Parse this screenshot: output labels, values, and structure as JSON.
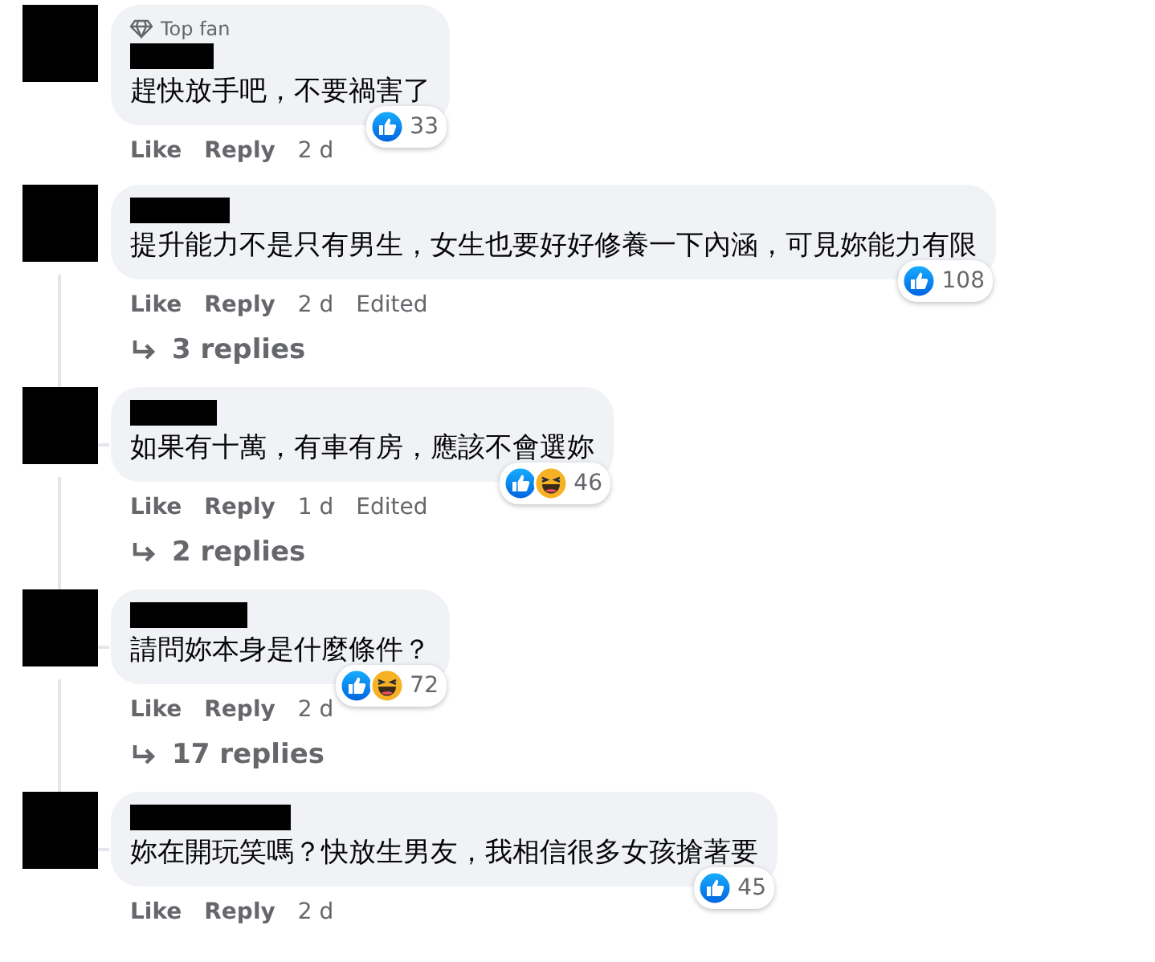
{
  "comments": [
    {
      "top_fan": true,
      "badge": "Top fan",
      "text": "趕快放手吧，不要禍害了",
      "reactions": [
        {
          "kind": "like"
        }
      ],
      "reaction_count": "33",
      "actions": {
        "like": "Like",
        "reply": "Reply",
        "time": "2 d"
      }
    },
    {
      "top_fan": false,
      "text": "提升能力不是只有男生，女生也要好好修養一下內涵，可見妳能力有限",
      "reactions": [
        {
          "kind": "like"
        }
      ],
      "reaction_count": "108",
      "actions": {
        "like": "Like",
        "reply": "Reply",
        "time": "2 d",
        "edited": "Edited"
      },
      "replies": "3 replies"
    },
    {
      "top_fan": false,
      "text": "如果有十萬，有車有房，應該不會選妳",
      "reactions": [
        {
          "kind": "like"
        },
        {
          "kind": "haha"
        }
      ],
      "reaction_count": "46",
      "actions": {
        "like": "Like",
        "reply": "Reply",
        "time": "1 d",
        "edited": "Edited"
      },
      "replies": "2 replies"
    },
    {
      "top_fan": false,
      "text": "請問妳本身是什麼條件？",
      "reactions": [
        {
          "kind": "like"
        },
        {
          "kind": "haha"
        }
      ],
      "reaction_count": "72",
      "actions": {
        "like": "Like",
        "reply": "Reply",
        "time": "2 d"
      },
      "replies": "17 replies"
    },
    {
      "top_fan": false,
      "text": "妳在開玩笑嗎？快放生男友，我相信很多女孩搶著要",
      "reactions": [
        {
          "kind": "like"
        }
      ],
      "reaction_count": "45",
      "actions": {
        "like": "Like",
        "reply": "Reply",
        "time": "2 d"
      }
    }
  ]
}
